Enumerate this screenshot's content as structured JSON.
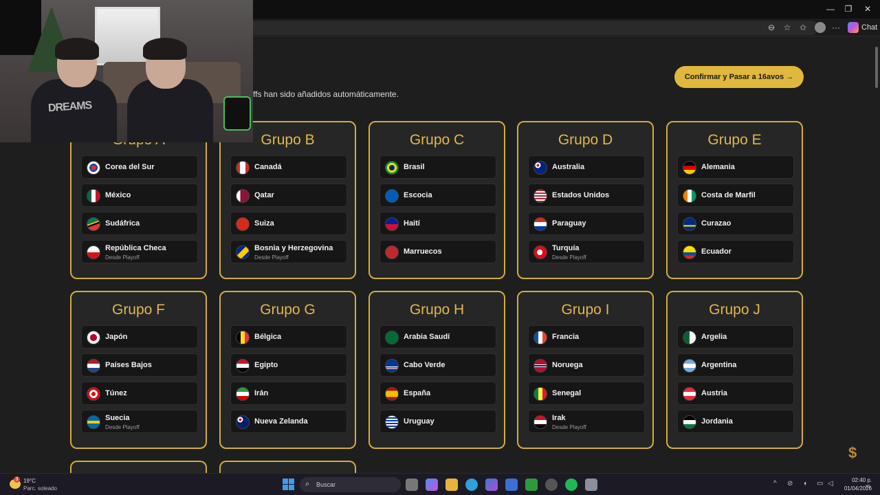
{
  "window": {
    "minimize": "—",
    "maximize": "❐",
    "close": "✕"
  },
  "browser": {
    "chat_label": "Chat"
  },
  "header": {
    "subtitle": "ffs han sido añadidos automáticamente.",
    "confirm_button": "Confirmar y Pasar a 16avos →"
  },
  "groups": [
    {
      "title": "Grupo A",
      "teams": [
        {
          "name": "Corea del Sur",
          "flag": "kr"
        },
        {
          "name": "México",
          "flag": "mx"
        },
        {
          "name": "Sudáfrica",
          "flag": "za"
        },
        {
          "name": "República Checa",
          "flag": "cz",
          "sub": "Desde Playoff"
        }
      ]
    },
    {
      "title": "Grupo B",
      "teams": [
        {
          "name": "Canadá",
          "flag": "ca"
        },
        {
          "name": "Qatar",
          "flag": "qa"
        },
        {
          "name": "Suiza",
          "flag": "ch"
        },
        {
          "name": "Bosnia y Herzegovina",
          "flag": "ba",
          "sub": "Desde Playoff"
        }
      ]
    },
    {
      "title": "Grupo C",
      "teams": [
        {
          "name": "Brasil",
          "flag": "br"
        },
        {
          "name": "Escocia",
          "flag": "sc"
        },
        {
          "name": "Haití",
          "flag": "ht"
        },
        {
          "name": "Marruecos",
          "flag": "ma"
        }
      ]
    },
    {
      "title": "Grupo D",
      "teams": [
        {
          "name": "Australia",
          "flag": "au"
        },
        {
          "name": "Estados Unidos",
          "flag": "us"
        },
        {
          "name": "Paraguay",
          "flag": "py"
        },
        {
          "name": "Turquía",
          "flag": "tr",
          "sub": "Desde Playoff"
        }
      ]
    },
    {
      "title": "Grupo E",
      "teams": [
        {
          "name": "Alemania",
          "flag": "de"
        },
        {
          "name": "Costa de Marfil",
          "flag": "ci"
        },
        {
          "name": "Curazao",
          "flag": "cw"
        },
        {
          "name": "Ecuador",
          "flag": "ec"
        }
      ]
    },
    {
      "title": "Grupo F",
      "teams": [
        {
          "name": "Japón",
          "flag": "jp"
        },
        {
          "name": "Países Bajos",
          "flag": "nl"
        },
        {
          "name": "Túnez",
          "flag": "tn"
        },
        {
          "name": "Suecia",
          "flag": "se",
          "sub": "Desde Playoff"
        }
      ]
    },
    {
      "title": "Grupo G",
      "teams": [
        {
          "name": "Bélgica",
          "flag": "be"
        },
        {
          "name": "Egipto",
          "flag": "eg"
        },
        {
          "name": "Irán",
          "flag": "ir"
        },
        {
          "name": "Nueva Zelanda",
          "flag": "nz"
        }
      ]
    },
    {
      "title": "Grupo H",
      "teams": [
        {
          "name": "Arabia Saudí",
          "flag": "sa"
        },
        {
          "name": "Cabo Verde",
          "flag": "cv"
        },
        {
          "name": "España",
          "flag": "es"
        },
        {
          "name": "Uruguay",
          "flag": "uy"
        }
      ]
    },
    {
      "title": "Grupo I",
      "teams": [
        {
          "name": "Francia",
          "flag": "fr"
        },
        {
          "name": "Noruega",
          "flag": "no"
        },
        {
          "name": "Senegal",
          "flag": "sn"
        },
        {
          "name": "Irak",
          "flag": "iq",
          "sub": "Desde Playoff"
        }
      ]
    },
    {
      "title": "Grupo J",
      "teams": [
        {
          "name": "Argelia",
          "flag": "dz"
        },
        {
          "name": "Argentina",
          "flag": "ar"
        },
        {
          "name": "Austria",
          "flag": "at"
        },
        {
          "name": "Jordania",
          "flag": "jo"
        }
      ]
    }
  ],
  "webcam": {
    "shirt_text": "DREAMS"
  },
  "taskbar": {
    "weather_badge": "3",
    "temperature": "19°C",
    "weather_desc": "Parc. soleado",
    "search_label": "Buscar",
    "time": "02:40 p. m.",
    "date": "01/04/2026"
  },
  "colors": {
    "accent": "#e0b83d",
    "group_border": "#d4ad3c",
    "group_title": "#e2b84a",
    "background": "#1e1e1e"
  }
}
